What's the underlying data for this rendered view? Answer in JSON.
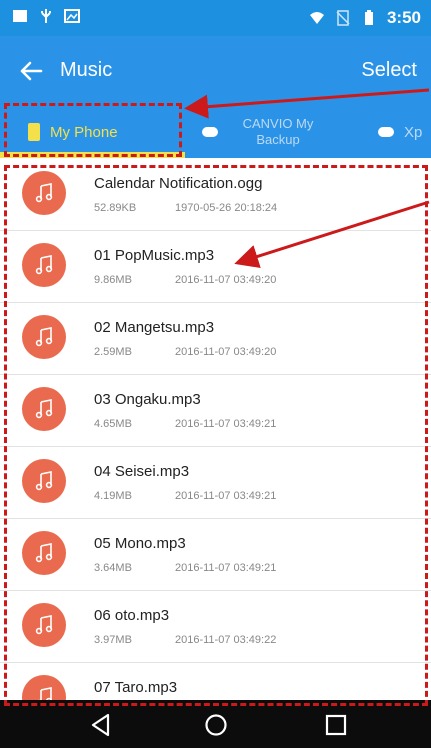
{
  "status": {
    "time": "3:50",
    "icons": [
      "notification-icon",
      "usb-icon",
      "image-icon",
      "wifi-icon",
      "sim-off-icon",
      "battery-icon"
    ]
  },
  "header": {
    "title": "Music",
    "action": "Select"
  },
  "tabs": [
    {
      "label": "My Phone",
      "icon": "phone-icon",
      "active": true
    },
    {
      "label": "CANVIO My Backup",
      "icon": "cloud-icon",
      "active": false
    },
    {
      "label": "Xp",
      "icon": "cloud-icon",
      "active": false
    }
  ],
  "files": [
    {
      "name": "Calendar Notification.ogg",
      "size": "52.89KB",
      "date": "1970-05-26 20:18:24"
    },
    {
      "name": "01 PopMusic.mp3",
      "size": "9.86MB",
      "date": "2016-11-07 03:49:20"
    },
    {
      "name": "02 Mangetsu.mp3",
      "size": "2.59MB",
      "date": "2016-11-07 03:49:20"
    },
    {
      "name": "03 Ongaku.mp3",
      "size": "4.65MB",
      "date": "2016-11-07 03:49:21"
    },
    {
      "name": "04 Seisei.mp3",
      "size": "4.19MB",
      "date": "2016-11-07 03:49:21"
    },
    {
      "name": "05 Mono.mp3",
      "size": "3.64MB",
      "date": "2016-11-07 03:49:21"
    },
    {
      "name": "06 oto.mp3",
      "size": "3.97MB",
      "date": "2016-11-07 03:49:22"
    },
    {
      "name": "07 Taro.mp3",
      "size": "",
      "date": ""
    }
  ],
  "navbar": [
    "back-icon",
    "home-icon",
    "recents-icon"
  ],
  "colors": {
    "appbar": "#2a93e8",
    "active_tab": "#f3e04a",
    "file_icon": "#e96a4e",
    "annotation": "#cc1a1a"
  }
}
